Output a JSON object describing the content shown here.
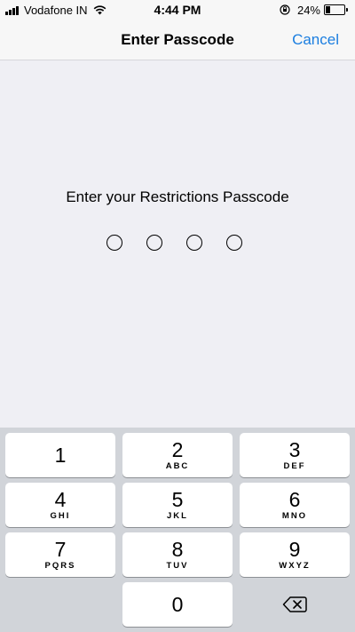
{
  "status_bar": {
    "carrier": "Vodafone IN",
    "time": "4:44 PM",
    "battery_percent": "24%",
    "battery_level": 0.24,
    "signal_icon": "signal-bars-icon",
    "wifi_icon": "wifi-icon",
    "orientation_lock_icon": "orientation-lock-icon",
    "battery_icon": "battery-icon"
  },
  "nav": {
    "title": "Enter Passcode",
    "cancel_label": "Cancel",
    "accent_color": "#1b7ee0"
  },
  "prompt": {
    "text": "Enter your Restrictions Passcode",
    "digits_entered": 0,
    "total_digits": 4
  },
  "keypad": {
    "keys": [
      {
        "digit": "1",
        "letters": ""
      },
      {
        "digit": "2",
        "letters": "ABC"
      },
      {
        "digit": "3",
        "letters": "DEF"
      },
      {
        "digit": "4",
        "letters": "GHI"
      },
      {
        "digit": "5",
        "letters": "JKL"
      },
      {
        "digit": "6",
        "letters": "MNO"
      },
      {
        "digit": "7",
        "letters": "PQRS"
      },
      {
        "digit": "8",
        "letters": "TUV"
      },
      {
        "digit": "9",
        "letters": "WXYZ"
      },
      {
        "digit": "0",
        "letters": ""
      }
    ],
    "delete_icon": "delete-backspace-icon"
  }
}
